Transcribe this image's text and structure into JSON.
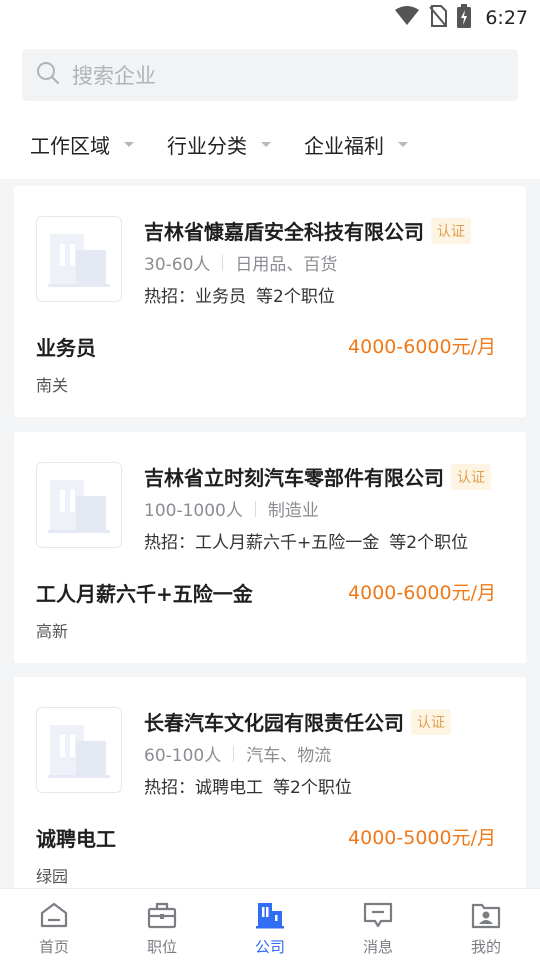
{
  "status_bar": {
    "time": "6:27",
    "icons": [
      "wifi-icon",
      "no-sim-icon",
      "battery-charging-icon"
    ]
  },
  "search": {
    "placeholder": "搜索企业",
    "icon": "search-icon"
  },
  "filters": [
    {
      "label": "工作区域"
    },
    {
      "label": "行业分类"
    },
    {
      "label": "企业福利"
    }
  ],
  "companies": [
    {
      "name": "吉林省慷嘉盾安全科技有限公司",
      "badge": "认证",
      "size": "30-60人",
      "industry": "日用品、百货",
      "hot_prefix": "热招：",
      "hot_job": "业务员",
      "hot_more": "等2个职位",
      "job_title": "业务员",
      "salary": "4000-6000元/月",
      "area": "南关"
    },
    {
      "name": "吉林省立时刻汽车零部件有限公司",
      "badge": "认证",
      "size": "100-1000人",
      "industry": "制造业",
      "hot_prefix": "热招：",
      "hot_job": "工人月薪六千+五险一金",
      "hot_more": "等2个职位",
      "job_title": "工人月薪六千+五险一金",
      "salary": "4000-6000元/月",
      "area": "高新"
    },
    {
      "name": "长春汽车文化园有限责任公司",
      "badge": "认证",
      "size": "60-100人",
      "industry": "汽车、物流",
      "hot_prefix": "热招：",
      "hot_job": "诚聘电工",
      "hot_more": "等2个职位",
      "job_title": "诚聘电工",
      "salary": "4000-5000元/月",
      "area": "绿园"
    }
  ],
  "tabbar": [
    {
      "label": "首页",
      "icon": "home-icon",
      "active": false
    },
    {
      "label": "职位",
      "icon": "briefcase-icon",
      "active": false
    },
    {
      "label": "公司",
      "icon": "building-icon",
      "active": true
    },
    {
      "label": "消息",
      "icon": "message-icon",
      "active": false
    },
    {
      "label": "我的",
      "icon": "profile-icon",
      "active": false
    }
  ],
  "colors": {
    "accent": "#2f6ef5",
    "salary": "#f07a1a",
    "badge_text": "#e0a050",
    "badge_bg": "#fdf4e4"
  }
}
